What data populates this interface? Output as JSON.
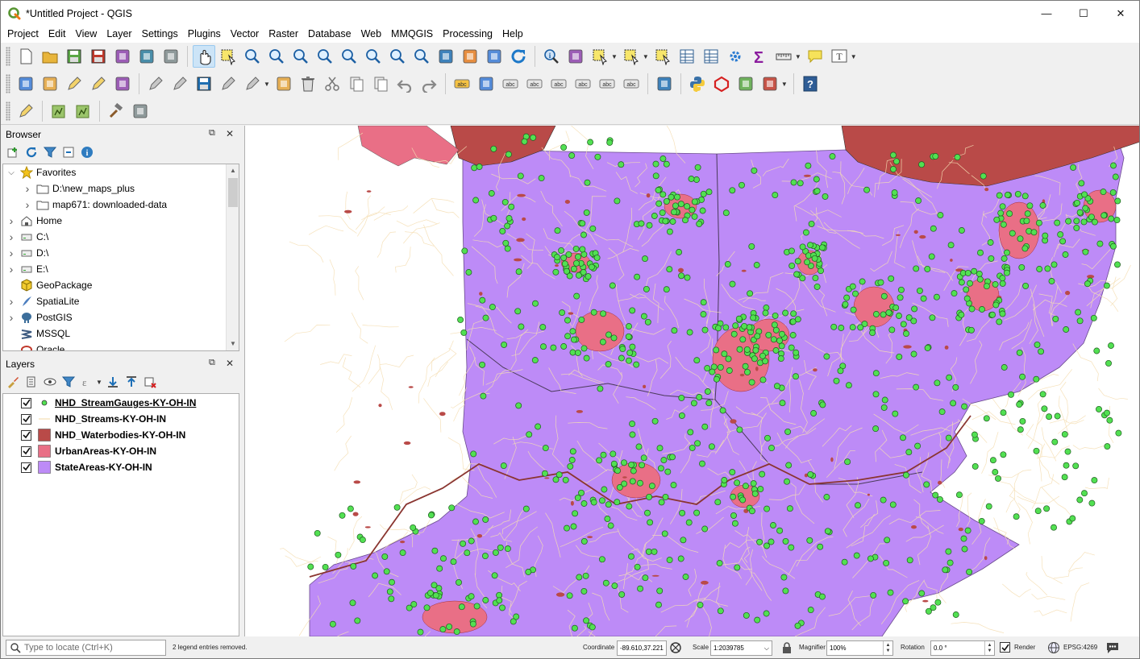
{
  "window": {
    "title": "*Untitled Project - QGIS",
    "controls": {
      "minimize": "—",
      "maximize": "☐",
      "close": "✕"
    }
  },
  "menubar": [
    "Project",
    "Edit",
    "View",
    "Layer",
    "Settings",
    "Plugins",
    "Vector",
    "Raster",
    "Database",
    "Web",
    "MMQGIS",
    "Processing",
    "Help"
  ],
  "browser": {
    "title": "Browser",
    "items": [
      {
        "label": "Favorites",
        "icon": "star-icon",
        "expanded": true,
        "indent": 0
      },
      {
        "label": "D:\\new_maps_plus",
        "icon": "folder-icon",
        "expanded": false,
        "indent": 1
      },
      {
        "label": "map671: downloaded-data",
        "icon": "folder-icon",
        "expanded": false,
        "indent": 1
      },
      {
        "label": "Home",
        "icon": "home-icon",
        "expanded": false,
        "indent": 0
      },
      {
        "label": "C:\\",
        "icon": "drive-icon",
        "expanded": false,
        "indent": 0
      },
      {
        "label": "D:\\",
        "icon": "drive-icon",
        "expanded": false,
        "indent": 0
      },
      {
        "label": "E:\\",
        "icon": "drive-icon",
        "expanded": false,
        "indent": 0
      },
      {
        "label": "GeoPackage",
        "icon": "geopackage-icon",
        "expanded": false,
        "indent": 0
      },
      {
        "label": "SpatiaLite",
        "icon": "spatialite-icon",
        "expanded": false,
        "indent": 0
      },
      {
        "label": "PostGIS",
        "icon": "postgis-icon",
        "expanded": false,
        "indent": 0
      },
      {
        "label": "MSSQL",
        "icon": "mssql-icon",
        "expanded": false,
        "indent": 0
      },
      {
        "label": "Oracle",
        "icon": "oracle-icon",
        "expanded": false,
        "indent": 0
      }
    ]
  },
  "layers": {
    "title": "Layers",
    "items": [
      {
        "name": "NHD_StreamGauges-KY-OH-IN",
        "checked": true,
        "symbol": "point",
        "color": "#52e052",
        "underlined": true
      },
      {
        "name": "NHD_Streams-KY-OH-IN",
        "checked": true,
        "symbol": "line",
        "color": "#f5deb3"
      },
      {
        "name": "NHD_Waterbodies-KY-OH-IN",
        "checked": true,
        "symbol": "fill",
        "color": "#b94a48"
      },
      {
        "name": "UrbanAreas-KY-OH-IN",
        "checked": true,
        "symbol": "fill",
        "color": "#e96f86"
      },
      {
        "name": "StateAreas-KY-OH-IN",
        "checked": true,
        "symbol": "fill",
        "color": "#bd8bf7"
      }
    ]
  },
  "statusbar": {
    "locator_placeholder": "Type to locate (Ctrl+K)",
    "message": "2 legend entries removed.",
    "coordinate_label": "Coordinate",
    "coordinate_value": "-89.610,37.221",
    "scale_label": "Scale",
    "scale_value": "1:2039785",
    "magnifier_label": "Magnifier",
    "magnifier_value": "100%",
    "rotation_label": "Rotation",
    "rotation_value": "0.0 °",
    "render_label": "Render",
    "render_checked": true,
    "crs": "EPSG:4269"
  },
  "toolbar_icons": {
    "row1": [
      "new-project-icon",
      "open-project-icon",
      "save-project-icon",
      "save-as-icon",
      "new-print-layout-icon",
      "layout-manager-icon",
      "style-manager-icon",
      "|",
      "pan-map-icon",
      "pan-to-selection-icon",
      "zoom-in-icon",
      "zoom-out-icon",
      "zoom-native-icon",
      "zoom-full-icon",
      "zoom-to-selection-icon",
      "zoom-to-layer-icon",
      "zoom-last-icon",
      "zoom-next-icon",
      "new-map-view-icon",
      "new-3d-view-icon",
      "temporal-icon",
      "refresh-icon",
      "|",
      "identify-icon",
      "action-icon",
      "select-features-icon",
      "select-by-value-icon",
      "deselect-icon",
      "attribute-table-icon",
      "field-calculator-icon",
      "processing-toolbox-icon",
      "statistics-icon",
      "measure-icon",
      "map-tips-icon",
      "text-annotation-icon"
    ],
    "row2": [
      "data-source-manager-icon",
      "new-geopackage-icon",
      "digitize-icon",
      "georeferencer-icon",
      "new-virtual-layer-icon",
      "|",
      "current-edits-icon",
      "toggle-editing-icon",
      "save-edits-icon",
      "add-feature-icon",
      "vertex-tool-icon",
      "modify-attributes-icon",
      "delete-icon",
      "cut-icon",
      "copy-icon",
      "paste-icon",
      "undo-icon",
      "redo-icon",
      "|",
      "label-icon",
      "diagram-icon",
      "highlight-pinned-icon",
      "pin-labels-icon",
      "show-hide-labels-icon",
      "move-label-icon",
      "rotate-label-icon",
      "change-label-icon",
      "|",
      "plugin-manager-icon",
      "|",
      "python-console-icon",
      "topology-icon",
      "layer-manager-icon",
      "add-layer-icon",
      "|",
      "help-icon"
    ],
    "row3": [
      "offline-editing-icon",
      "|",
      "grass-icon",
      "grass-tools-icon",
      "|",
      "hammer-icon",
      "gps-icon"
    ]
  }
}
